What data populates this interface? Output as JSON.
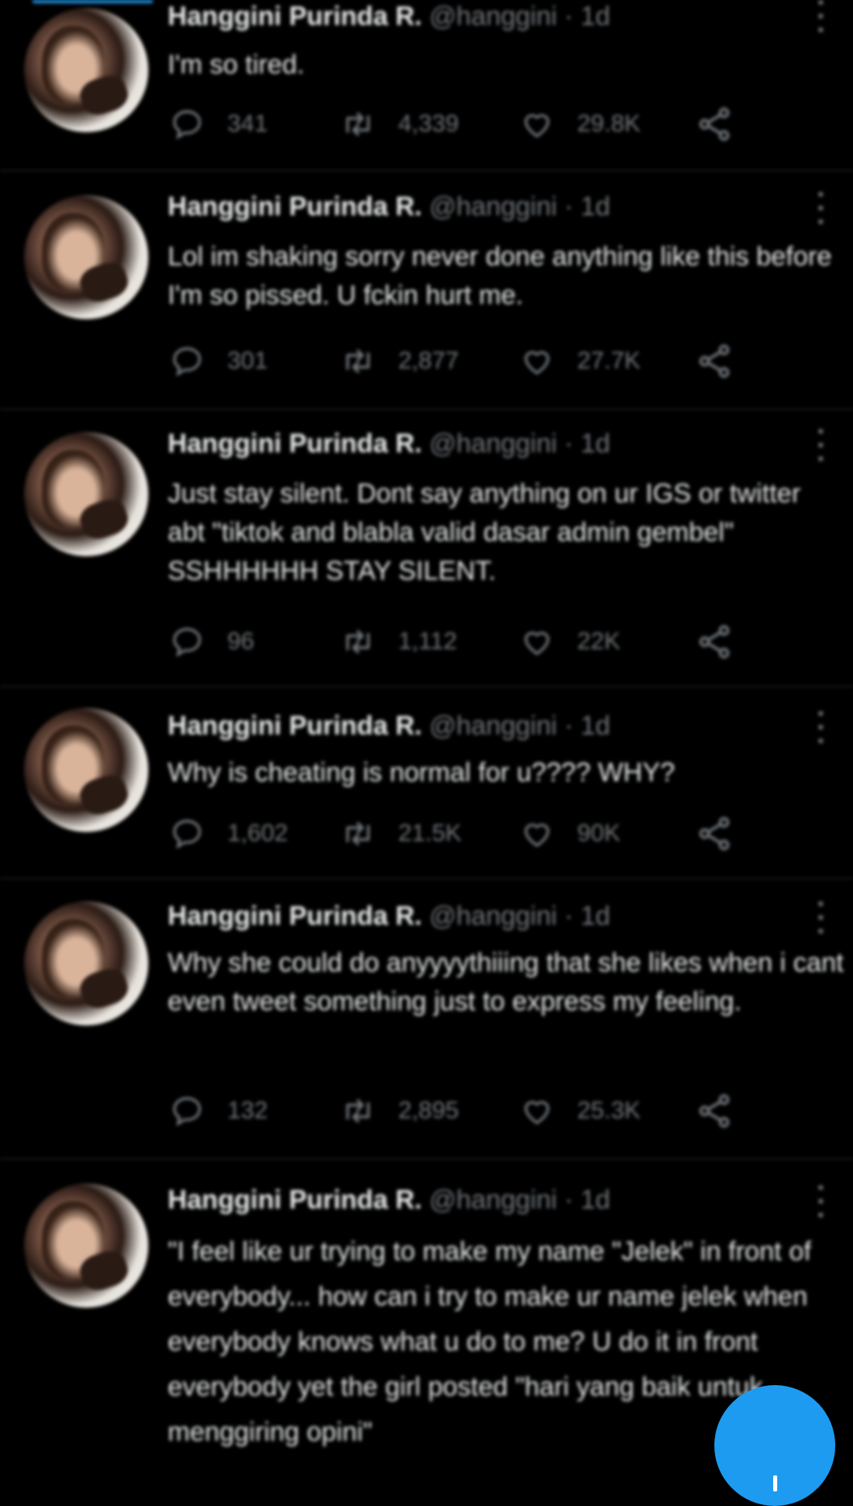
{
  "app": {
    "accent_color": "#1d9bf0",
    "background_color": "#000000"
  },
  "tweets": [
    {
      "author": "Hanggini Purinda R.",
      "handle": "@hanggini",
      "separator": "·",
      "time": "1d",
      "text": "I'm so tired.",
      "replies": "341",
      "retweets": "4,339",
      "likes": "29.8K"
    },
    {
      "author": "Hanggini Purinda R.",
      "handle": "@hanggini",
      "separator": "·",
      "time": "1d",
      "text": "Lol im shaking sorry never done anything like this before I'm so pissed. U fckin hurt me.",
      "replies": "301",
      "retweets": "2,877",
      "likes": "27.7K"
    },
    {
      "author": "Hanggini Purinda R.",
      "handle": "@hanggini",
      "separator": "·",
      "time": "1d",
      "text": "Just stay silent. Dont say anything on ur IGS or twitter abt \"tiktok and blabla valid dasar admin gembel\" SSHHHHHH STAY SILENT.",
      "replies": "96",
      "retweets": "1,112",
      "likes": "22K"
    },
    {
      "author": "Hanggini Purinda R.",
      "handle": "@hanggini",
      "separator": "·",
      "time": "1d",
      "text": "Why is cheating is normal for u???? WHY?",
      "replies": "1,602",
      "retweets": "21.5K",
      "likes": "90K"
    },
    {
      "author": "Hanggini Purinda R.",
      "handle": "@hanggini",
      "separator": "·",
      "time": "1d",
      "text": "Why  she could do anyyyythiiing that she likes when i cant even tweet something just to express my feeling.",
      "replies": "132",
      "retweets": "2,895",
      "likes": "25.3K"
    },
    {
      "author": "Hanggini Purinda R.",
      "handle": "@hanggini",
      "separator": "·",
      "time": "1d",
      "text": "\"I feel like ur trying to make my name \"Jelek\" in front of everybody... how can i try to make ur name jelek when everybody knows what u do to me? U do it in front everybody yet the girl posted \"hari yang baik untuk menggiring opini\"",
      "replies": "",
      "retweets": "",
      "likes": ""
    }
  ],
  "icons": {
    "reply": "reply-icon",
    "retweet": "retweet-icon",
    "like": "heart-icon",
    "share": "share-icon",
    "more": "more-options-icon",
    "compose": "compose-icon"
  }
}
